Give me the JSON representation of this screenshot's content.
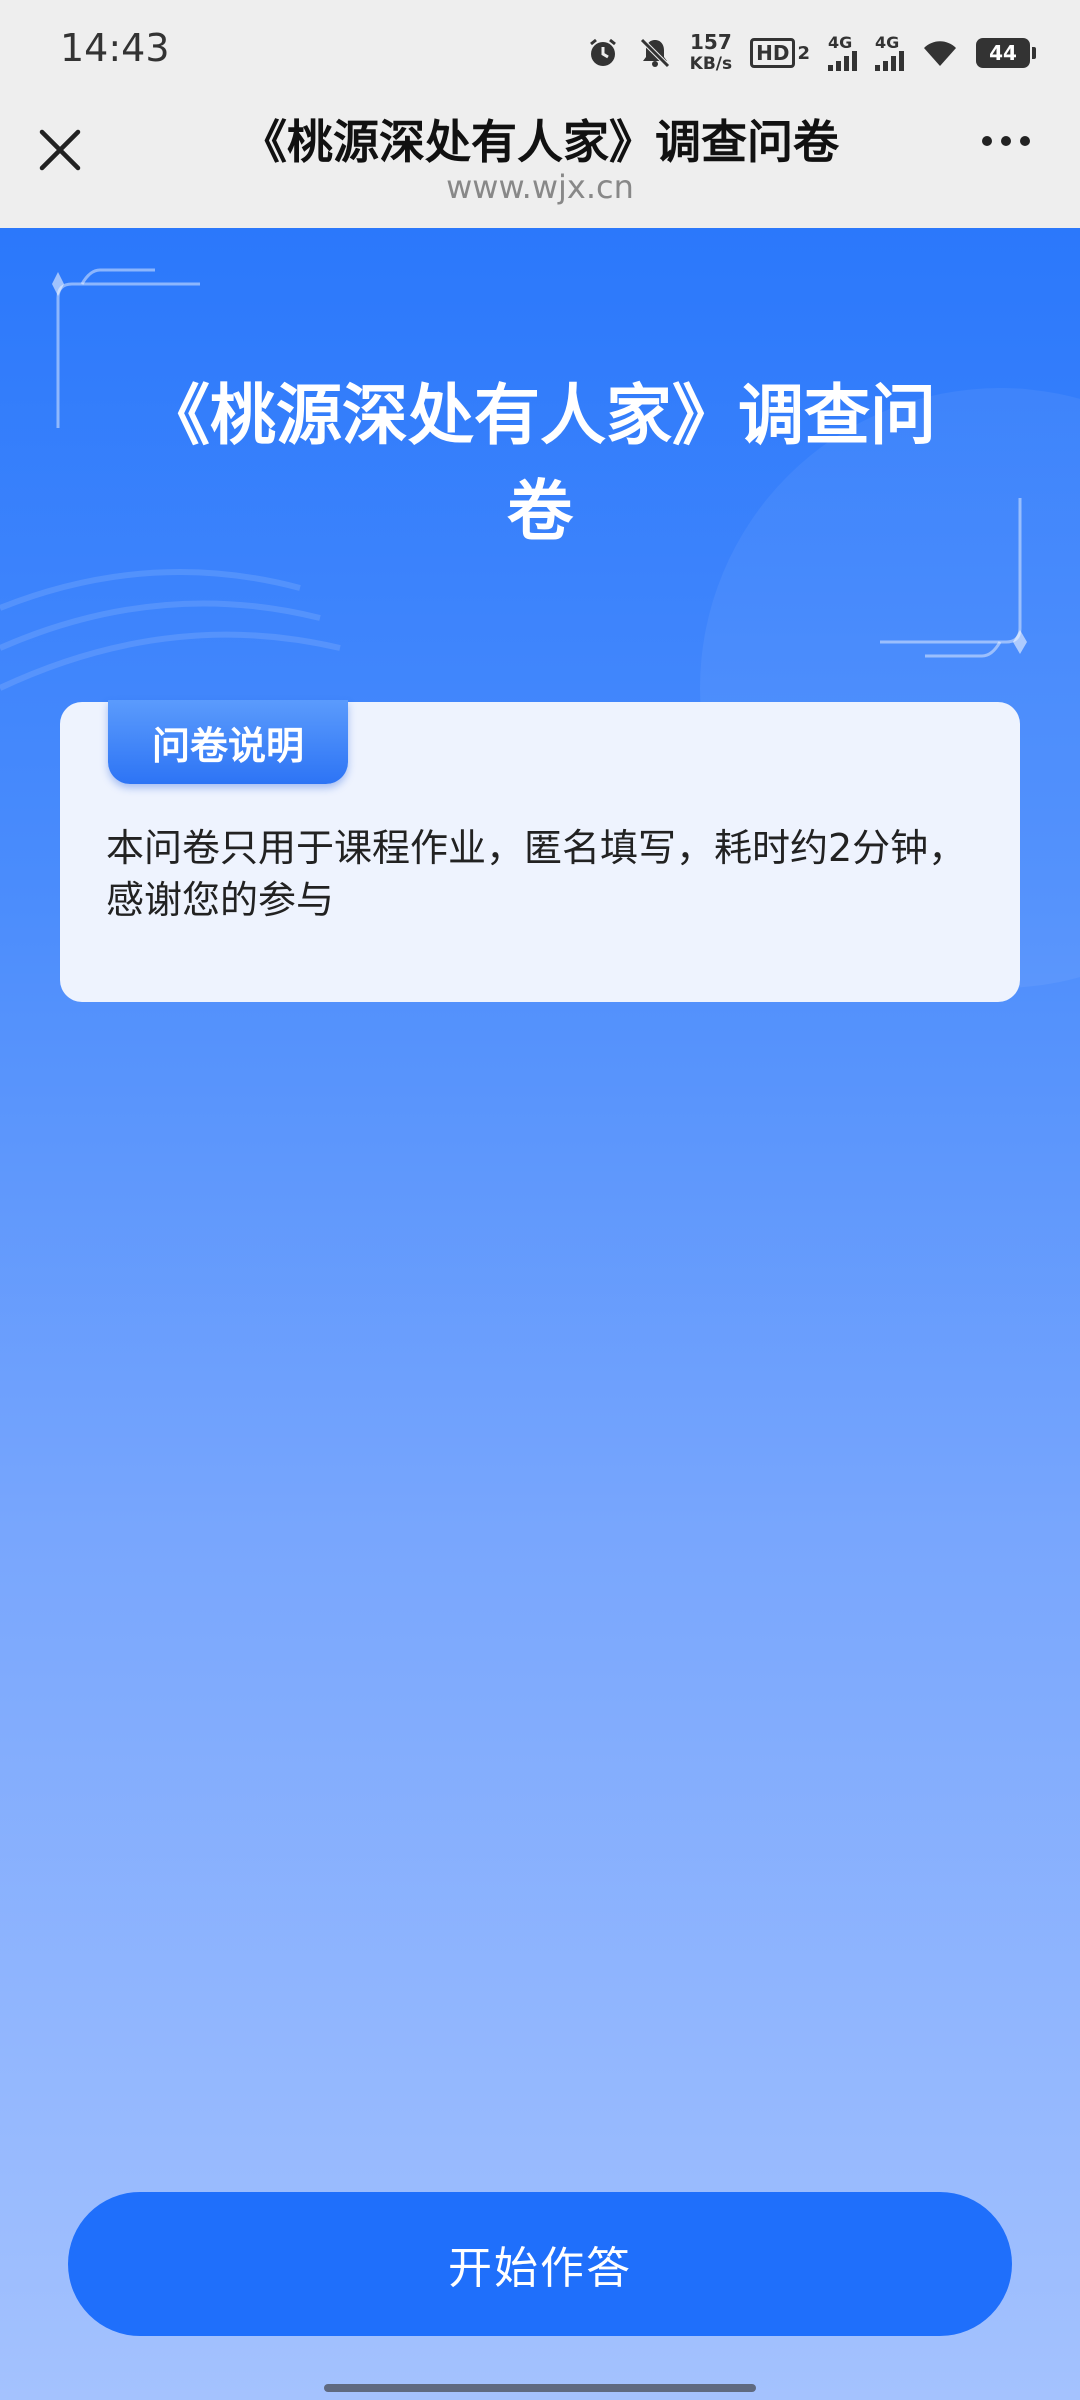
{
  "status_bar": {
    "time": "14:43",
    "net_speed_value": "157",
    "net_speed_unit": "KB/s",
    "hd_label": "HD",
    "hd_sub": "2",
    "signal1_label": "4G",
    "signal2_label": "4G",
    "battery": "44",
    "icons": [
      "alarm-icon",
      "mute-icon",
      "wifi-icon"
    ]
  },
  "nav": {
    "title": "《桃源深处有人家》调查问卷",
    "url": "www.wjx.cn",
    "icons": [
      "close-icon",
      "more-icon"
    ]
  },
  "survey": {
    "title": "《桃源深处有人家》调查问卷",
    "intro_tab": "问卷说明",
    "intro_text": "本问卷只用于课程作业，匿名填写，耗时约2分钟，感谢您的参与"
  },
  "start_button": "开始作答",
  "colors": {
    "accent": "#1f6ffb",
    "gradient_top": "#2b78fb",
    "gradient_bottom": "#a4c2fe",
    "card_bg": "#eef3fe"
  }
}
